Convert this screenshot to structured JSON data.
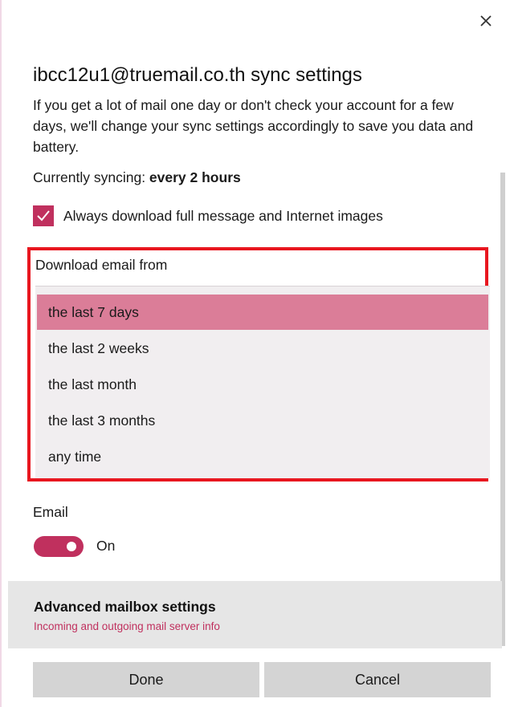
{
  "dialog": {
    "title": "ibcc12u1@truemail.co.th sync settings",
    "description": "If you get a lot of mail one day or don't check your account for a few days, we'll change your sync settings accordingly to save you data and battery.",
    "currently_label": "Currently syncing: ",
    "currently_value": "every 2 hours",
    "checkbox_label": "Always download full message and Internet images",
    "checkbox_checked": true,
    "close_icon": "close-icon"
  },
  "download_dropdown": {
    "label": "Download email from",
    "selected_index": 0,
    "options": [
      "the last 7 days",
      "the last 2 weeks",
      "the last month",
      "the last 3 months",
      "any time"
    ]
  },
  "email_toggle": {
    "label": "Email",
    "state_text": "On",
    "on": true
  },
  "advanced": {
    "title": "Advanced mailbox settings",
    "subtitle": "Incoming and outgoing mail server info"
  },
  "buttons": {
    "done": "Done",
    "cancel": "Cancel"
  },
  "colors": {
    "accent": "#c0305e",
    "selected_option": "#db7d98",
    "highlight_border": "#e8161f"
  }
}
